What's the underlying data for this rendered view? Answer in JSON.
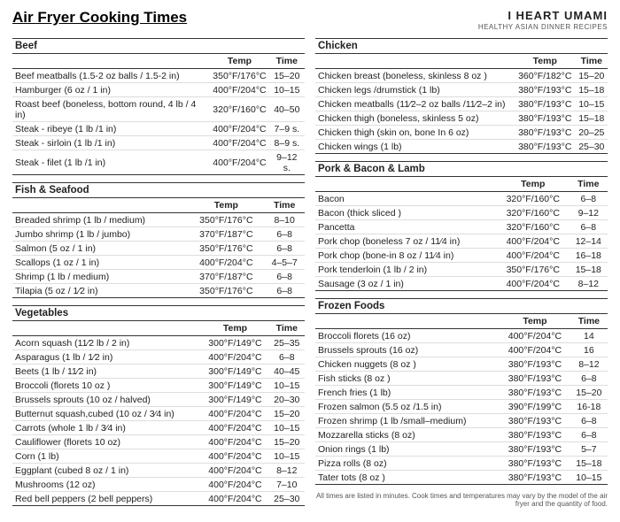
{
  "header": {
    "title": "Air Fryer Cooking Times",
    "logo_main": "I HEART UMAMI",
    "logo_sub": "HEALTHY ASIAN DINNER RECIPES"
  },
  "sections": {
    "beef": {
      "title": "Beef",
      "headers": [
        "",
        "Temp",
        "Time"
      ],
      "rows": [
        [
          "Beef meatballs (1.5-2 oz balls / 1.5-2 in)",
          "350°F/176°C",
          "15–20"
        ],
        [
          "Hamburger (6 oz / 1 in)",
          "400°F/204°C",
          "10–15"
        ],
        [
          "Roast beef (boneless, bottom round, 4 lb / 4 in)",
          "320°F/160°C",
          "40–50"
        ],
        [
          "Steak - ribeye (1 lb /1 in)",
          "400°F/204°C",
          "7–9 s."
        ],
        [
          "Steak - sirloin (1 lb /1 in)",
          "400°F/204°C",
          "8–9 s."
        ],
        [
          "Steak - filet (1 lb /1 in)",
          "400°F/204°C",
          "9–12 s."
        ]
      ]
    },
    "chicken": {
      "title": "Chicken",
      "headers": [
        "",
        "Temp",
        "Time"
      ],
      "rows": [
        [
          "Chicken breast (boneless, skinless 8 oz )",
          "360°F/182°C",
          "15–20"
        ],
        [
          "Chicken legs /drumstick (1 lb)",
          "380°F/193°C",
          "15–18"
        ],
        [
          "Chicken meatballs (11⁄2–2 oz balls /11⁄2–2 in)",
          "380°F/193°C",
          "10–15"
        ],
        [
          "Chicken thigh (boneless, skinless 5 oz)",
          "380°F/193°C",
          "15–18"
        ],
        [
          "Chicken thigh (skin on, bone In 6 oz)",
          "380°F/193°C",
          "20–25"
        ],
        [
          "Chicken wings (1 lb)",
          "380°F/193°C",
          "25–30"
        ]
      ]
    },
    "fish": {
      "title": "Fish & Seafood",
      "headers": [
        "",
        "Temp",
        "Time"
      ],
      "rows": [
        [
          "Breaded shrimp (1 lb / medium)",
          "350°F/176°C",
          "8–10"
        ],
        [
          "Jumbo shrimp (1 lb / jumbo)",
          "370°F/187°C",
          "6–8"
        ],
        [
          "Salmon (5 oz / 1 in)",
          "350°F/176°C",
          "6–8"
        ],
        [
          "Scallops (1 oz / 1 in)",
          "400°F/204°C",
          "4–5–7"
        ],
        [
          "Shrimp (1 lb / medium)",
          "370°F/187°C",
          "6–8"
        ],
        [
          "Tilapia (5 oz / 1⁄2 in)",
          "350°F/176°C",
          "6–8"
        ]
      ]
    },
    "pork": {
      "title": "Pork & Bacon & Lamb",
      "headers": [
        "",
        "Temp",
        "Time"
      ],
      "rows": [
        [
          "Bacon",
          "320°F/160°C",
          "6–8"
        ],
        [
          "Bacon (thick sliced )",
          "320°F/160°C",
          "9–12"
        ],
        [
          "Pancetta",
          "320°F/160°C",
          "6–8"
        ],
        [
          "Pork chop (boneless 7 oz / 11⁄4 in)",
          "400°F/204°C",
          "12–14"
        ],
        [
          "Pork chop (bone-in 8 oz / 11⁄4 in)",
          "400°F/204°C",
          "16–18"
        ],
        [
          "Pork tenderloin (1 lb / 2 in)",
          "350°F/176°C",
          "15–18"
        ],
        [
          "Sausage (3 oz / 1 in)",
          "400°F/204°C",
          "8–12"
        ]
      ]
    },
    "vegetables": {
      "title": "Vegetables",
      "headers": [
        "",
        "Temp",
        "Time"
      ],
      "rows": [
        [
          "Acorn squash (11⁄2 lb / 2 in)",
          "300°F/149°C",
          "25–35"
        ],
        [
          "Asparagus (1 lb / 1⁄2 in)",
          "400°F/204°C",
          "6–8"
        ],
        [
          "Beets (1 lb / 11⁄2 in)",
          "300°F/149°C",
          "40–45"
        ],
        [
          "Broccoli (florets 10 oz )",
          "300°F/149°C",
          "10–15"
        ],
        [
          "Brussels sprouts (10 oz / halved)",
          "300°F/149°C",
          "20–30"
        ],
        [
          "Butternut squash,cubed (10 oz / 3⁄4 in)",
          "400°F/204°C",
          "15–20"
        ],
        [
          "Carrots (whole 1 lb / 3⁄4 in)",
          "400°F/204°C",
          "10–15"
        ],
        [
          "Cauliflower (florets 10 oz)",
          "400°F/204°C",
          "15–20"
        ],
        [
          "Corn (1 lb)",
          "400°F/204°C",
          "10–15"
        ],
        [
          "Eggplant (cubed 8 oz / 1 in)",
          "400°F/204°C",
          "8–12"
        ],
        [
          "Mushrooms (12 oz)",
          "400°F/204°C",
          "7–10"
        ],
        [
          "Red bell peppers (2 bell peppers)",
          "400°F/204°C",
          "25–30"
        ]
      ]
    },
    "frozen": {
      "title": "Frozen Foods",
      "headers": [
        "",
        "Temp",
        "Time"
      ],
      "rows": [
        [
          "Broccoli florets (16 oz)",
          "400°F/204°C",
          "14"
        ],
        [
          "Brussels sprouts (16 oz)",
          "400°F/204°C",
          "16"
        ],
        [
          "Chicken nuggets (8 oz )",
          "380°F/193°C",
          "8–12"
        ],
        [
          "Fish sticks (8 oz )",
          "380°F/193°C",
          "6–8"
        ],
        [
          "French fries (1 lb)",
          "380°F/193°C",
          "15–20"
        ],
        [
          "Frozen salmon (5.5 oz /1.5 in)",
          "390°F/199°C",
          "16-18"
        ],
        [
          "Frozen shrimp (1 lb /small–medium)",
          "380°F/193°C",
          "6–8"
        ],
        [
          "Mozzarella sticks (8 oz)",
          "380°F/193°C",
          "6–8"
        ],
        [
          "Onion rings (1 lb)",
          "380°F/193°C",
          "5–7"
        ],
        [
          "Pizza rolls (8 oz)",
          "380°F/193°C",
          "15–18"
        ],
        [
          "Tater tots (8 oz )",
          "380°F/193°C",
          "10–15"
        ]
      ]
    }
  },
  "footnote": "All times are listed in minutes. Cook times and temperatures may vary by the model of the air fryer and the quantity of food."
}
